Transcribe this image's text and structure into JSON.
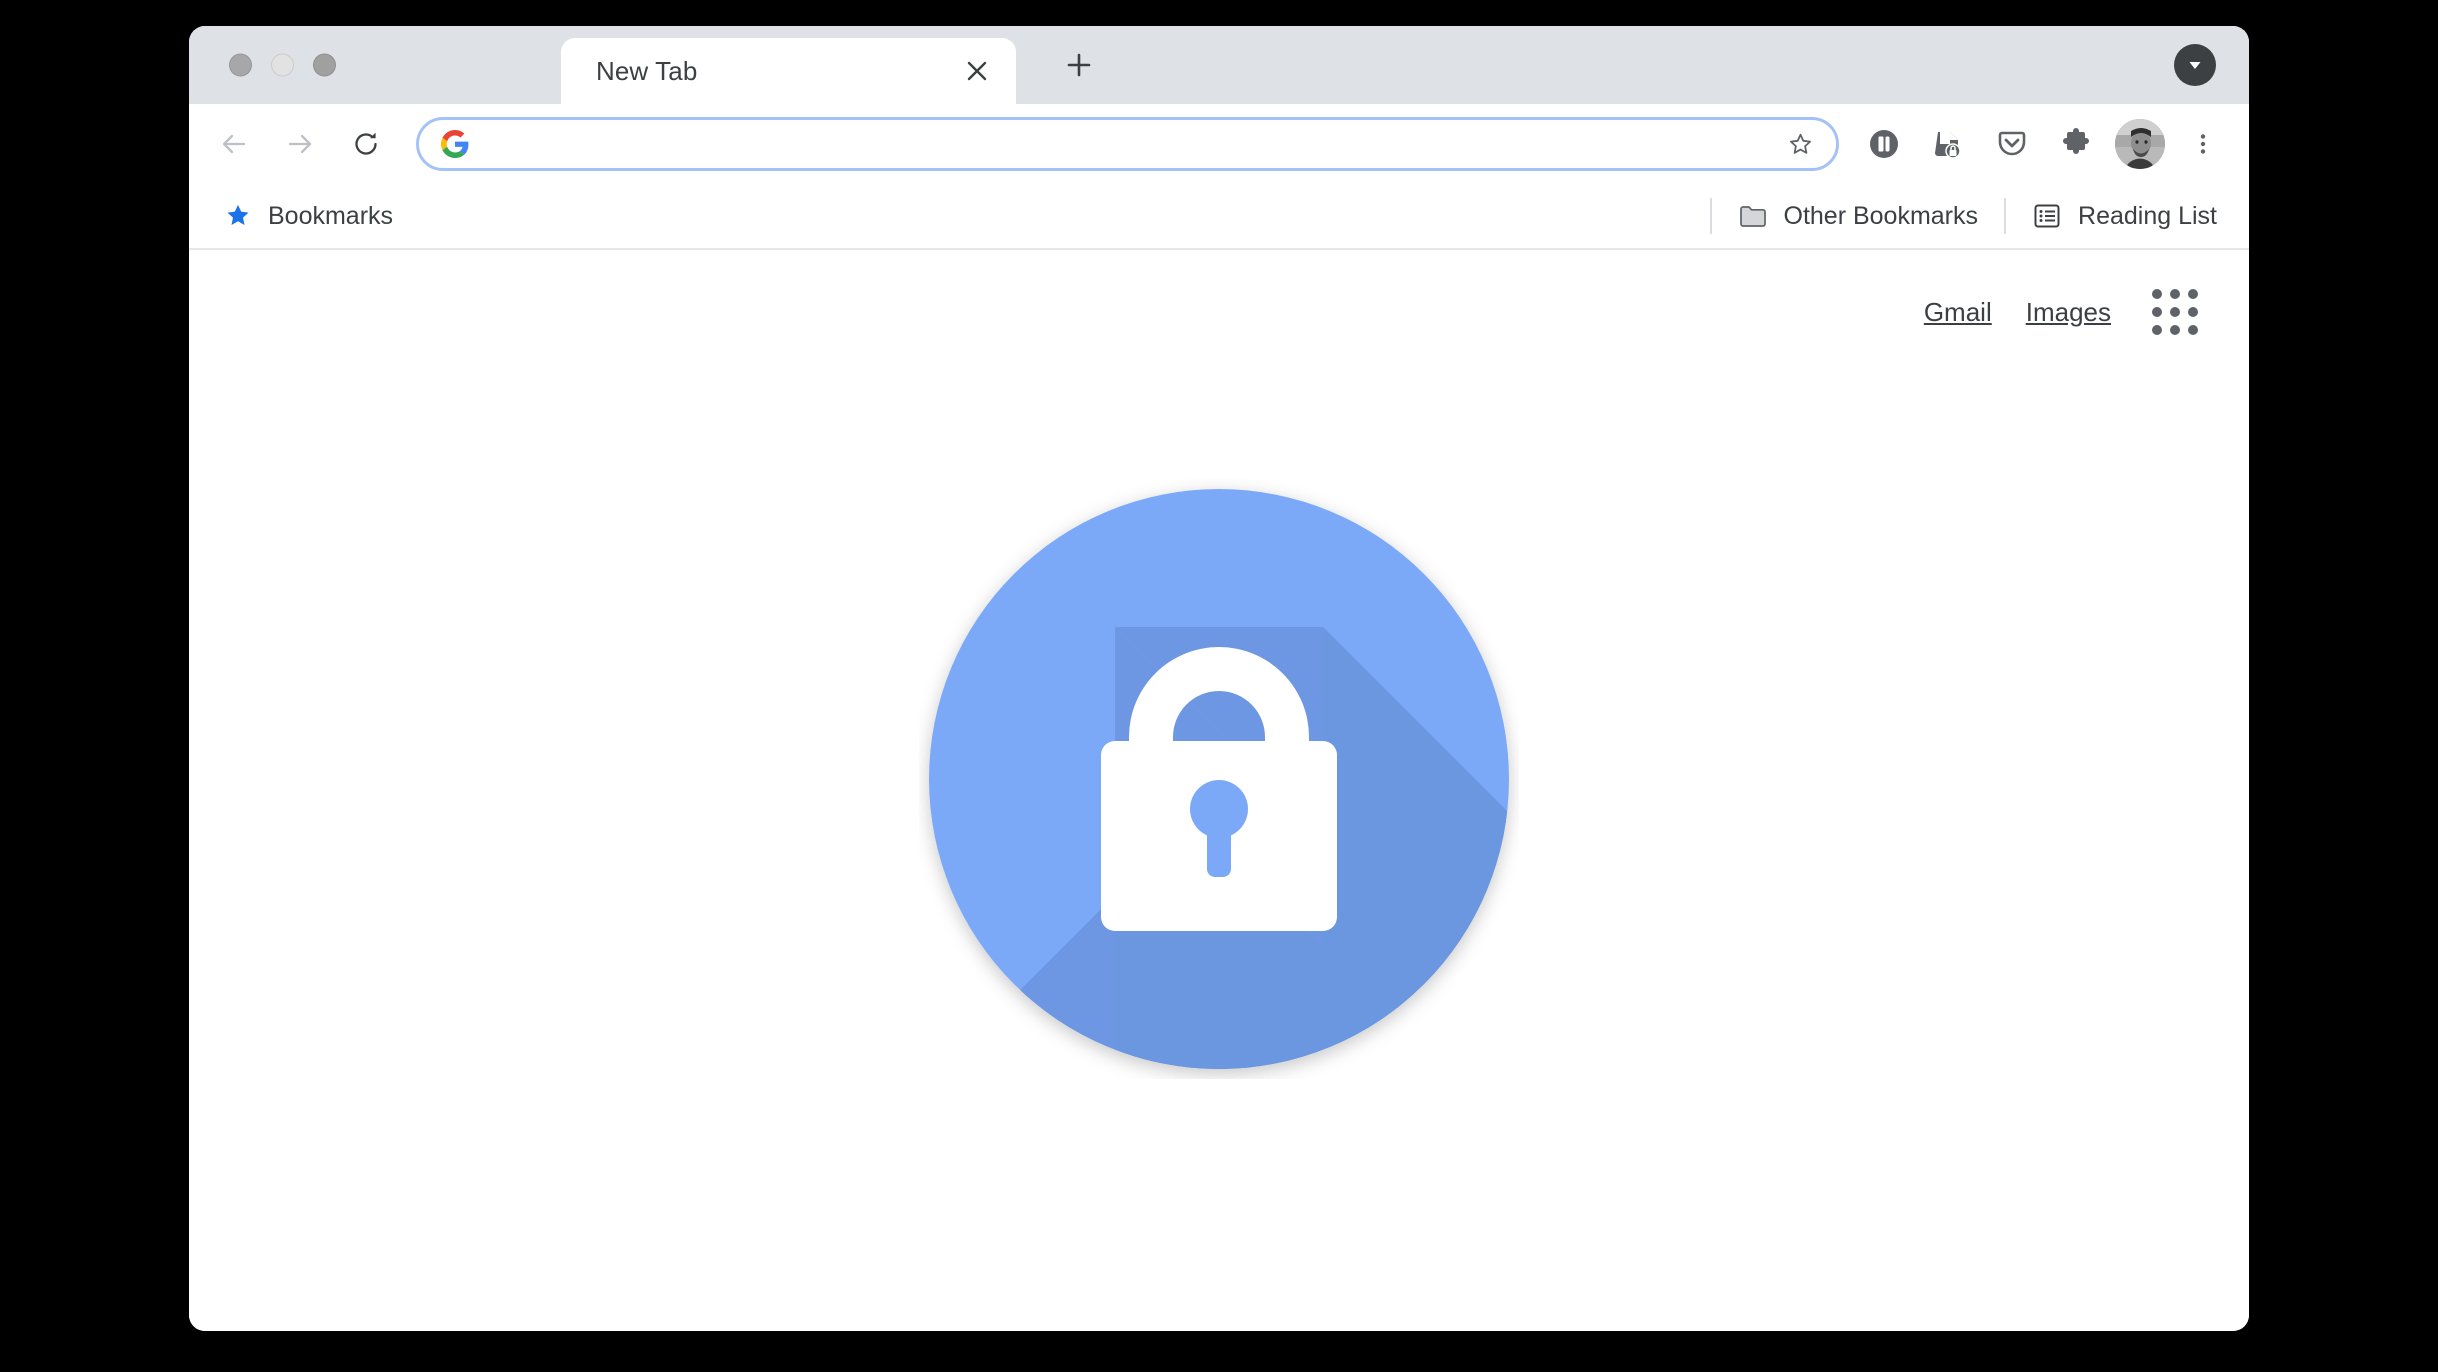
{
  "window": {
    "traffic_lights": [
      "close",
      "minimize",
      "zoom"
    ]
  },
  "tabstrip": {
    "tab_title": "New Tab",
    "close_icon": "close-icon",
    "new_tab_icon": "plus-icon",
    "tab_search_icon": "chevron-down-circle-icon"
  },
  "toolbar": {
    "back_icon": "arrow-left-icon",
    "forward_icon": "arrow-right-icon",
    "reload_icon": "reload-icon",
    "omnibox": {
      "value": "",
      "placeholder": "",
      "leading_icon": "google-g-icon",
      "bookmark_icon": "star-outline-icon"
    },
    "extensions": [
      {
        "name": "dark-reader-icon",
        "title": "Dark Reader"
      },
      {
        "name": "password-manager-icon",
        "title": "Password Manager"
      },
      {
        "name": "pocket-icon",
        "title": "Pocket"
      },
      {
        "name": "puzzle-icon",
        "title": "Extensions"
      }
    ],
    "avatar_icon": "profile-avatar",
    "menu_icon": "three-dot-menu-icon"
  },
  "bookmarks_bar": {
    "left": [
      {
        "icon": "star-filled-icon",
        "label": "Bookmarks",
        "color": "#1a73e8"
      }
    ],
    "right": [
      {
        "icon": "folder-icon",
        "label": "Other Bookmarks"
      },
      {
        "icon": "reading-list-icon",
        "label": "Reading List"
      }
    ]
  },
  "new_tab_page": {
    "links": [
      {
        "label": "Gmail"
      },
      {
        "label": "Images"
      }
    ],
    "apps_grid_icon": "google-apps-grid-icon",
    "hero": {
      "name": "lock-icon-graphic",
      "circle_color": "#7ca9f7",
      "shadow_color": "#6b96e0",
      "lock_color": "#ffffff"
    }
  },
  "colors": {
    "page_background": "#000000",
    "tabstrip": "#dee1e6",
    "toolbar": "#ffffff",
    "omnibox_focus_ring": "#a5c2f8",
    "text_primary": "#3c4043",
    "icon_grey": "#5f6368",
    "icon_disabled": "#bdc1c6",
    "accent_blue": "#1a73e8"
  }
}
